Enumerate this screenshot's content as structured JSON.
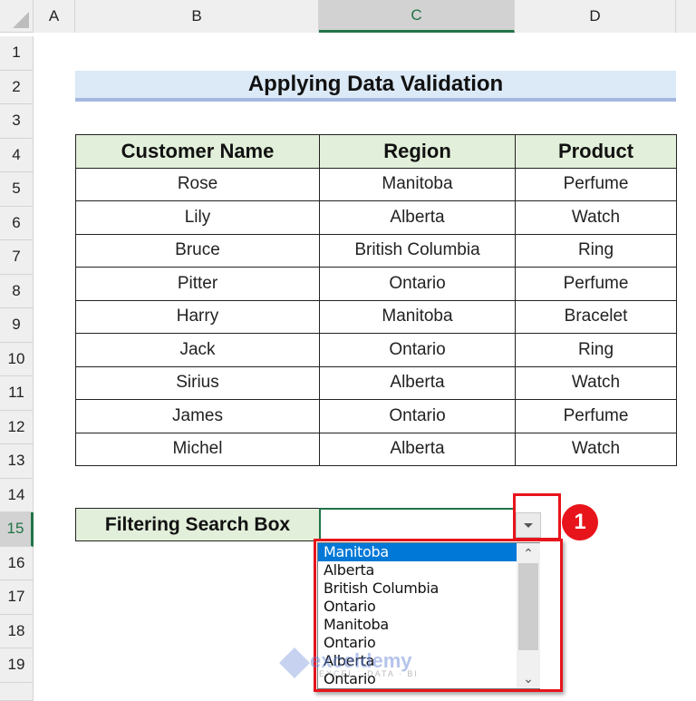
{
  "columns": [
    "A",
    "B",
    "C",
    "D"
  ],
  "selected_column": "C",
  "rows": [
    "1",
    "2",
    "3",
    "4",
    "5",
    "6",
    "7",
    "8",
    "9",
    "10",
    "11",
    "12",
    "13",
    "14",
    "15",
    "16",
    "17",
    "18",
    "19"
  ],
  "selected_row": "15",
  "title": "Applying Data Validation",
  "table": {
    "headers": [
      "Customer Name",
      "Region",
      "Product"
    ],
    "rows": [
      [
        "Rose",
        "Manitoba",
        "Perfume"
      ],
      [
        "Lily",
        "Alberta",
        "Watch"
      ],
      [
        "Bruce",
        "British Columbia",
        "Ring"
      ],
      [
        "Pitter",
        "Ontario",
        "Perfume"
      ],
      [
        "Harry",
        "Manitoba",
        "Bracelet"
      ],
      [
        "Jack",
        "Ontario",
        "Ring"
      ],
      [
        "Sirius",
        "Alberta",
        "Watch"
      ],
      [
        "James",
        "Ontario",
        "Perfume"
      ],
      [
        "Michel",
        "Alberta",
        "Watch"
      ]
    ]
  },
  "filter": {
    "label": "Filtering Search Box",
    "value": "",
    "dropdown_icon": "chevron-down-icon",
    "options": [
      "Manitoba",
      "Alberta",
      "British Columbia",
      "Ontario",
      "Manitoba",
      "Ontario",
      "Alberta",
      "Ontario"
    ],
    "selected_index": 0
  },
  "annotation": {
    "badge": "1",
    "color": "#e8141b"
  },
  "watermark": {
    "name": "exceldemy",
    "tagline": "EXCEL · DATA · BI"
  },
  "colors": {
    "header_green": "#e2efda",
    "title_blue": "#dce9f6",
    "excel_green": "#217346",
    "selection_blue": "#0078d7"
  }
}
